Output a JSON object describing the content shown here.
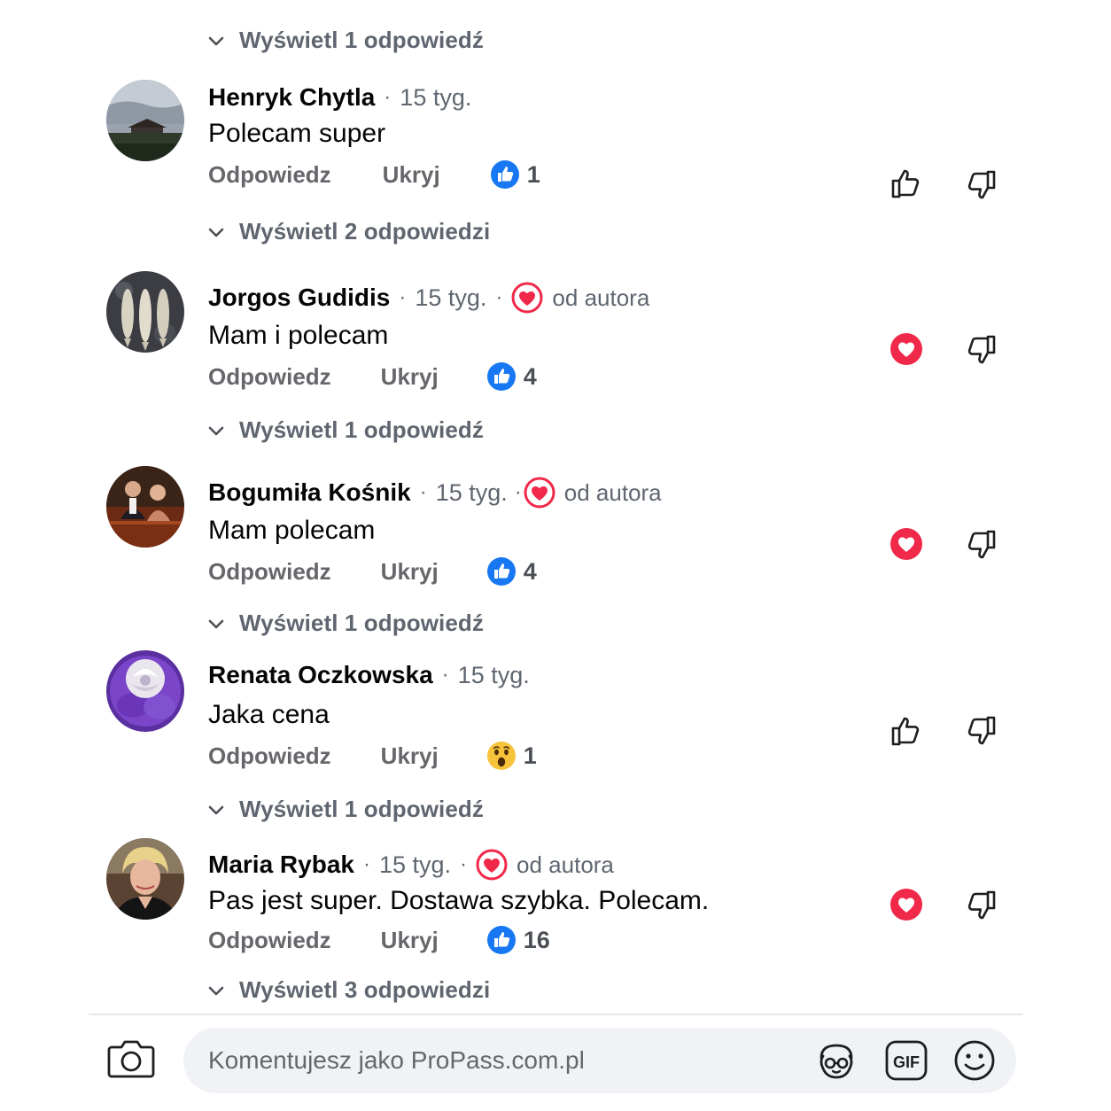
{
  "view_replies": [
    {
      "label": "Wyświetl 1 odpowiedź"
    },
    {
      "label": "Wyświetl 2 odpowiedzi"
    },
    {
      "label": "Wyświetl 1 odpowiedź"
    },
    {
      "label": "Wyświetl 1 odpowiedź"
    },
    {
      "label": "Wyświetl 1 odpowiedź"
    },
    {
      "label": "Wyświetl 3 odpowiedzi"
    }
  ],
  "comments": [
    {
      "author": "Henryk Chytla",
      "time": "15 tyg.",
      "text": "Polecam super",
      "reply": "Odpowiedz",
      "hide": "Ukryj",
      "reaction_icon": "like-icon",
      "reaction_count": "1",
      "author_liked": false
    },
    {
      "author": "Jorgos Gudidis",
      "time": "15 tyg.",
      "author_badge": "od autora",
      "text": "Mam i polecam",
      "reply": "Odpowiedz",
      "hide": "Ukryj",
      "reaction_icon": "like-icon",
      "reaction_count": "4",
      "author_liked": true
    },
    {
      "author": "Bogumiła Kośnik",
      "time": "15 tyg.",
      "author_badge": "od autora",
      "text": "Mam polecam",
      "reply": "Odpowiedz",
      "hide": "Ukryj",
      "reaction_icon": "like-icon",
      "reaction_count": "4",
      "author_liked": true
    },
    {
      "author": "Renata Oczkowska",
      "time": "15 tyg.",
      "text": "Jaka cena",
      "reply": "Odpowiedz",
      "hide": "Ukryj",
      "reaction_icon": "wow-icon",
      "reaction_count": "1",
      "author_liked": false
    },
    {
      "author": "Maria Rybak",
      "time": "15 tyg.",
      "author_badge": "od autora",
      "text": "Pas jest super. Dostawa szybka. Polecam.",
      "reply": "Odpowiedz",
      "hide": "Ukryj",
      "reaction_icon": "like-icon",
      "reaction_count": "16",
      "author_liked": true
    }
  ],
  "composer": {
    "placeholder": "Komentujesz jako ProPass.com.pl",
    "icons": [
      "camera-icon",
      "avatar-sticker-icon",
      "gif-icon",
      "emoji-icon"
    ]
  },
  "colors": {
    "like_blue": "#1877f2",
    "heart_red": "#f02849",
    "muted_text": "#65676b",
    "composer_bg": "#f0f2f5"
  }
}
